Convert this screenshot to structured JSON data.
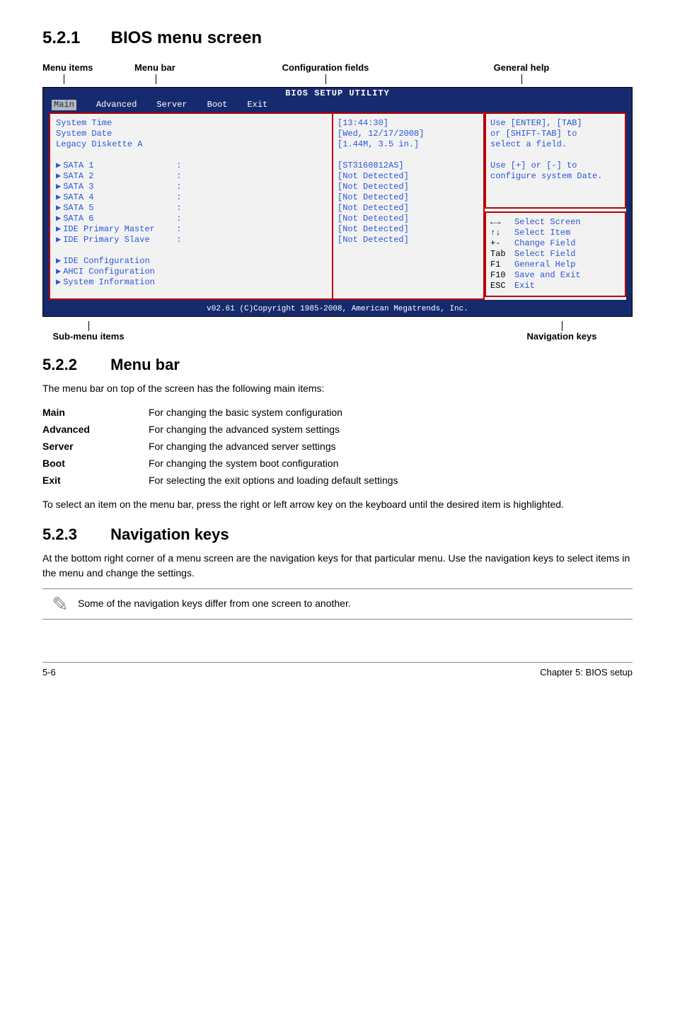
{
  "sections": {
    "s521_num": "5.2.1",
    "s521_title": "BIOS menu screen",
    "s522_num": "5.2.2",
    "s522_title": "Menu bar",
    "s523_num": "5.2.3",
    "s523_title": "Navigation keys"
  },
  "top_labels": {
    "menu_items": "Menu items",
    "menu_bar": "Menu bar",
    "config_fields": "Configuration fields",
    "general_help": "General help"
  },
  "bios": {
    "title": "BIOS SETUP UTILITY",
    "menubar": {
      "main": "Main",
      "advanced": "Advanced",
      "server": "Server",
      "boot": "Boot",
      "exit": "Exit"
    },
    "left": {
      "system_time": "System Time",
      "system_date": "System Date",
      "legacy": "Legacy Diskette A",
      "sata1": "SATA 1",
      "sata2": "SATA 2",
      "sata3": "SATA 3",
      "sata4": "SATA 4",
      "sata5": "SATA 5",
      "sata6": "SATA 6",
      "ide_pm": "IDE Primary Master",
      "ide_ps": "IDE Primary Slave",
      "ide_cfg": "IDE Configuration",
      "ahci_cfg": "AHCI Configuration",
      "sys_info": "System Information"
    },
    "mid": {
      "time": "[13:44:30]",
      "date": "[Wed, 12/17/2008]",
      "legacy": "[1.44M, 3.5 in.]",
      "sata1": "[ST3160812AS]",
      "nd": "[Not Detected]"
    },
    "right_top": {
      "l1": "Use [ENTER], [TAB]",
      "l2": "or [SHIFT-TAB] to",
      "l3": "select a field.",
      "l4": "Use [+] or [-] to",
      "l5": "configure system Date."
    },
    "right_bot": {
      "arrow_lr": "←→",
      "select_screen": "Select Screen",
      "arrow_ud": "↑↓",
      "select_item": "Select Item",
      "pm": "+-",
      "change_field": "Change Field",
      "tab": "Tab",
      "select_field": "Select Field",
      "f1": "F1",
      "general_help": "General Help",
      "f10": "F10",
      "save_exit": "Save and Exit",
      "esc": "ESC",
      "exit": "Exit"
    },
    "footer": "v02.61 (C)Copyright 1985-2008, American Megatrends, Inc."
  },
  "below_labels": {
    "submenu": "Sub-menu items",
    "navkeys": "Navigation keys"
  },
  "menubar_text": "The menu bar on top of the screen has the following main items:",
  "defs": {
    "main_k": "Main",
    "main_v": "For changing the basic system configuration",
    "adv_k": "Advanced",
    "adv_v": "For changing the advanced system settings",
    "srv_k": "Server",
    "srv_v": "For changing the advanced server settings",
    "boot_k": "Boot",
    "boot_v": "For changing the system boot configuration",
    "exit_k": "Exit",
    "exit_v": "For selecting the exit options and loading default settings"
  },
  "menubar_after": "To select an item on the menu bar, press the right or left arrow key on the keyboard until the desired item is highlighted.",
  "navkeys_text": "At the bottom right corner of a menu screen are the navigation keys for that particular menu. Use the navigation keys to select items in the menu and change the settings.",
  "note_text": "Some of the navigation keys differ from one screen to another.",
  "footer": {
    "left": "5-6",
    "right": "Chapter 5: BIOS setup"
  }
}
